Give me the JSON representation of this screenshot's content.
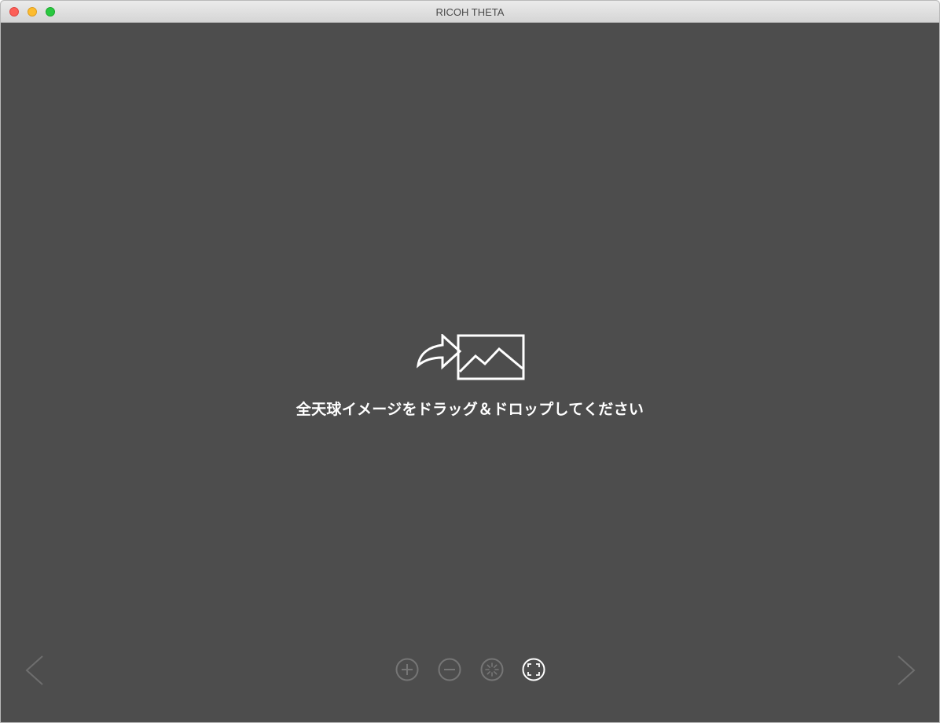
{
  "window": {
    "title": "RICOH THETA"
  },
  "main": {
    "drop_message": "全天球イメージをドラッグ＆ドロップしてください",
    "drop_icon": "drag-image-icon"
  },
  "controls": {
    "zoom_in_icon": "plus-circle-icon",
    "zoom_out_icon": "minus-circle-icon",
    "autoplay_icon": "spin-circle-icon",
    "fit_icon": "fit-screen-icon",
    "active_color": "#ffffff",
    "inactive_color": "#7a7a7a"
  },
  "navigation": {
    "prev_icon": "chevron-left-icon",
    "next_icon": "chevron-right-icon"
  },
  "colors": {
    "background": "#4d4d4d",
    "titlebar": "#e3e3e3",
    "text": "#ffffff"
  }
}
